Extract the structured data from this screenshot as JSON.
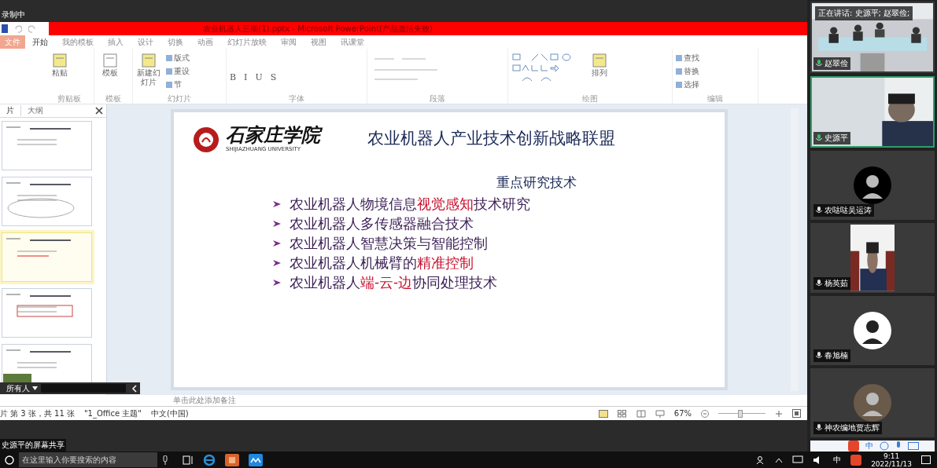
{
  "recording": {
    "label": "录制中"
  },
  "title_bar": {
    "title": "农业机器人三期(1).pptx - Microsoft PowerPoint(产品激活失败)"
  },
  "ribbon_tabs": [
    {
      "label": "文件",
      "selected": false,
      "kind": "file"
    },
    {
      "label": "开始",
      "selected": true,
      "kind": "tab"
    },
    {
      "label": "我的模板",
      "selected": false,
      "kind": "tab"
    },
    {
      "label": "插入",
      "selected": false,
      "kind": "tab"
    },
    {
      "label": "设计",
      "selected": false,
      "kind": "tab"
    },
    {
      "label": "切换",
      "selected": false,
      "kind": "tab"
    },
    {
      "label": "动画",
      "selected": false,
      "kind": "tab"
    },
    {
      "label": "幻灯片放映",
      "selected": false,
      "kind": "tab"
    },
    {
      "label": "审阅",
      "selected": false,
      "kind": "tab"
    },
    {
      "label": "视图",
      "selected": false,
      "kind": "tab"
    },
    {
      "label": "讯课堂",
      "selected": false,
      "kind": "tab"
    }
  ],
  "ribbon_groups": [
    {
      "label": "剪贴板",
      "items": [
        {
          "label": "粘贴",
          "kind": "large"
        }
      ]
    },
    {
      "label": "模板",
      "items": [
        {
          "label": "模板",
          "kind": "large"
        }
      ]
    },
    {
      "label": "幻灯片",
      "items": [
        {
          "label": "新建幻灯片",
          "kind": "large"
        },
        {
          "label": "版式",
          "kind": "small"
        },
        {
          "label": "重设",
          "kind": "small"
        },
        {
          "label": "节",
          "kind": "small"
        }
      ]
    },
    {
      "label": "字体",
      "items": [
        {
          "label": "B",
          "kind": "format"
        },
        {
          "label": "I",
          "kind": "format"
        },
        {
          "label": "U",
          "kind": "format"
        },
        {
          "label": "S",
          "kind": "format"
        }
      ]
    },
    {
      "label": "段落"
    },
    {
      "label": "绘图",
      "items": [
        {
          "label": "排列",
          "kind": "large"
        }
      ]
    },
    {
      "label": "编辑",
      "items": [
        {
          "label": "查找",
          "kind": "small"
        },
        {
          "label": "替换",
          "kind": "small"
        },
        {
          "label": "选择",
          "kind": "small"
        }
      ]
    }
  ],
  "slide_pane": {
    "tabs": [
      {
        "label": "片",
        "selected": true
      },
      {
        "label": "大纲",
        "selected": false
      }
    ],
    "thumbnails": [
      {
        "selected": false
      },
      {
        "selected": false
      },
      {
        "selected": true
      },
      {
        "selected": false
      },
      {
        "selected": false
      }
    ]
  },
  "slide": {
    "school_name": "石家庄学院",
    "school_name_en": "SHIJIAZHUANG UNIVERSITY",
    "title": "农业机器人产业技术创新战略联盟",
    "subtitle": "重点研究技术",
    "bullets": [
      [
        {
          "text": "农业机器人物境信息",
          "emphasis": false
        },
        {
          "text": "视觉感知",
          "emphasis": true
        },
        {
          "text": "技术研究",
          "emphasis": false
        }
      ],
      [
        {
          "text": "农业机器人多传感器融合技术",
          "emphasis": false
        }
      ],
      [
        {
          "text": "农业机器人智慧决策与智能控制",
          "emphasis": false
        }
      ],
      [
        {
          "text": "农业机器人机械臂的",
          "emphasis": false
        },
        {
          "text": "精准控制",
          "emphasis": true
        }
      ],
      [
        {
          "text": "农业机器人",
          "emphasis": false
        },
        {
          "text": "端-云-边",
          "emphasis": true
        },
        {
          "text": "协同处理技术",
          "emphasis": false
        }
      ]
    ]
  },
  "notes": {
    "placeholder": "单击此处添加备注"
  },
  "chat_bar": {
    "recipient": "所有人"
  },
  "zoom_slider": {
    "level": 0.45
  },
  "status_bar": {
    "slide_position": "片 第 3 张，共 11 张",
    "theme": "\"1_Office 主题\"",
    "language": "中文(中国)",
    "zoom": "67%"
  },
  "share_label": "史源平的屏幕共享",
  "participants": [
    {
      "name": "赵翠俭",
      "kind": "video",
      "speaking_label": "正在讲话: 史源平; 赵翠俭;",
      "active": false
    },
    {
      "name": "史源平",
      "kind": "video",
      "active": true
    },
    {
      "name": "农哒哒吴运涛",
      "kind": "avatar",
      "active": false
    },
    {
      "name": "杨英茹",
      "kind": "video",
      "active": false
    },
    {
      "name": "春旭楠",
      "kind": "avatar",
      "active": false
    },
    {
      "name": "神农编地贾志辉",
      "kind": "avatar",
      "active": false
    }
  ],
  "ime_bar": {
    "mode": "中"
  },
  "taskbar": {
    "search_placeholder": "在这里输入你要搜索的内容",
    "input_mode": "中",
    "time": "9:11",
    "date": "2022/11/13"
  }
}
